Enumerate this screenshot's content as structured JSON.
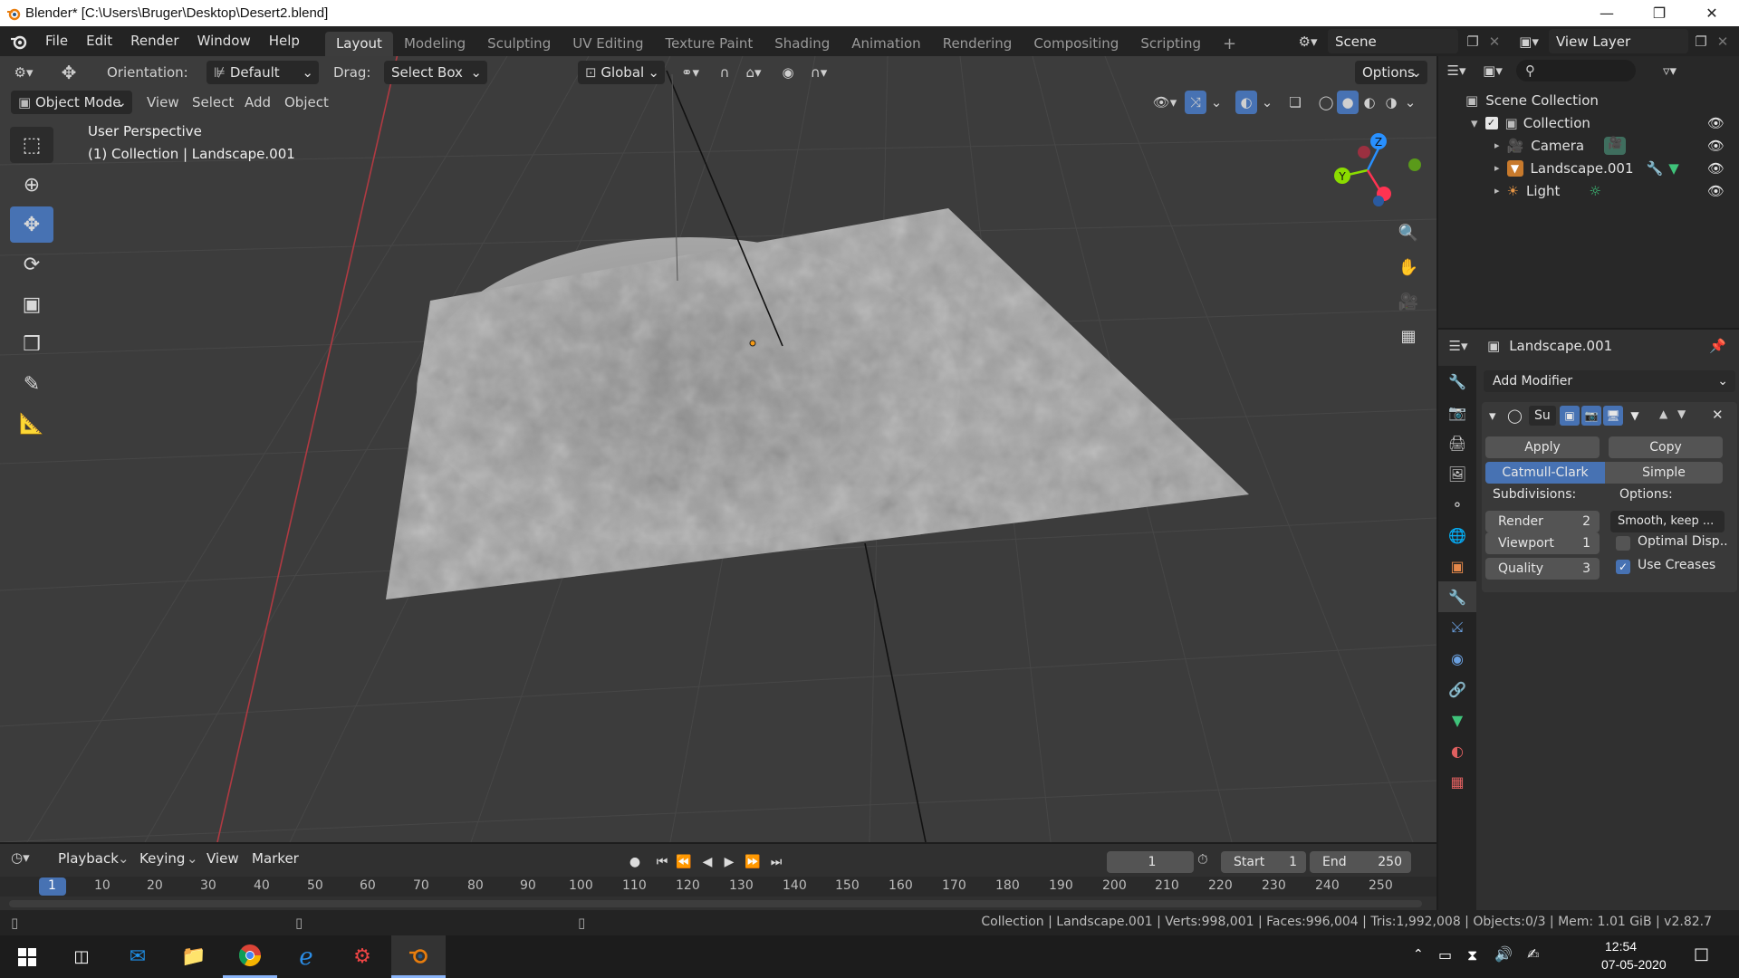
{
  "window": {
    "title": "Blender* [C:\\Users\\Bruger\\Desktop\\Desert2.blend]",
    "minimize_icon": "minimize-icon",
    "maximize_icon": "restore-icon",
    "close_icon": "close-icon"
  },
  "menu": {
    "items": [
      "File",
      "Edit",
      "Render",
      "Window",
      "Help"
    ]
  },
  "workspaces": {
    "tabs": [
      "Layout",
      "Modeling",
      "Sculpting",
      "UV Editing",
      "Texture Paint",
      "Shading",
      "Animation",
      "Rendering",
      "Compositing",
      "Scripting"
    ],
    "active": "Layout",
    "add": "+"
  },
  "scene": {
    "name": "Scene"
  },
  "view_layer": {
    "name": "View Layer"
  },
  "viewport_header": {
    "orientation_label": "Orientation:",
    "orientation_value": "Default",
    "drag_label": "Drag:",
    "drag_value": "Select Box",
    "transform_orientation": "Global",
    "options": "Options",
    "mode": "Object Mode",
    "menus": [
      "View",
      "Select",
      "Add",
      "Object"
    ]
  },
  "viewport": {
    "perspective": "User Perspective",
    "collection_info": "(1) Collection | Landscape.001",
    "gizmo": {
      "z": "Z",
      "y": "Y"
    }
  },
  "outliner": {
    "root": "Scene Collection",
    "items": [
      {
        "name": "Collection"
      },
      {
        "name": "Camera"
      },
      {
        "name": "Landscape.001"
      },
      {
        "name": "Light"
      }
    ]
  },
  "properties": {
    "object_name": "Landscape.001",
    "add_modifier": "Add Modifier",
    "modifier": {
      "short_name": "Su",
      "apply": "Apply",
      "copy": "Copy",
      "catmull": "Catmull-Clark",
      "simple": "Simple",
      "subdivisions_label": "Subdivisions:",
      "options_label": "Options:",
      "render_label": "Render",
      "render_value": "2",
      "viewport_label": "Viewport",
      "viewport_value": "1",
      "quality_label": "Quality",
      "quality_value": "3",
      "uv_smooth": "Smooth, keep ...",
      "optimal_display": "Optimal Disp..",
      "optimal_display_checked": false,
      "use_creases": "Use Creases",
      "use_creases_checked": true
    }
  },
  "timeline": {
    "menus": [
      "Playback",
      "Keying",
      "View",
      "Marker"
    ],
    "current_frame": "1",
    "start_label": "Start",
    "start_value": "1",
    "end_label": "End",
    "end_value": "250",
    "ruler": [
      "1",
      "10",
      "20",
      "30",
      "40",
      "50",
      "60",
      "70",
      "80",
      "90",
      "100",
      "110",
      "120",
      "130",
      "140",
      "150",
      "160",
      "170",
      "180",
      "190",
      "200",
      "210",
      "220",
      "230",
      "240",
      "250"
    ]
  },
  "status": {
    "text": "Collection | Landscape.001 | Verts:998,001 | Faces:996,004 | Tris:1,992,008 | Objects:0/3 | Mem: 1.01 GiB | v2.82.7"
  },
  "taskbar": {
    "time": "12:54",
    "date": "07-05-2020"
  },
  "colors": {
    "accent": "#4772b3",
    "x_axis": "#ff3352",
    "y_axis": "#8bdc00",
    "z_axis": "#2890ff"
  }
}
